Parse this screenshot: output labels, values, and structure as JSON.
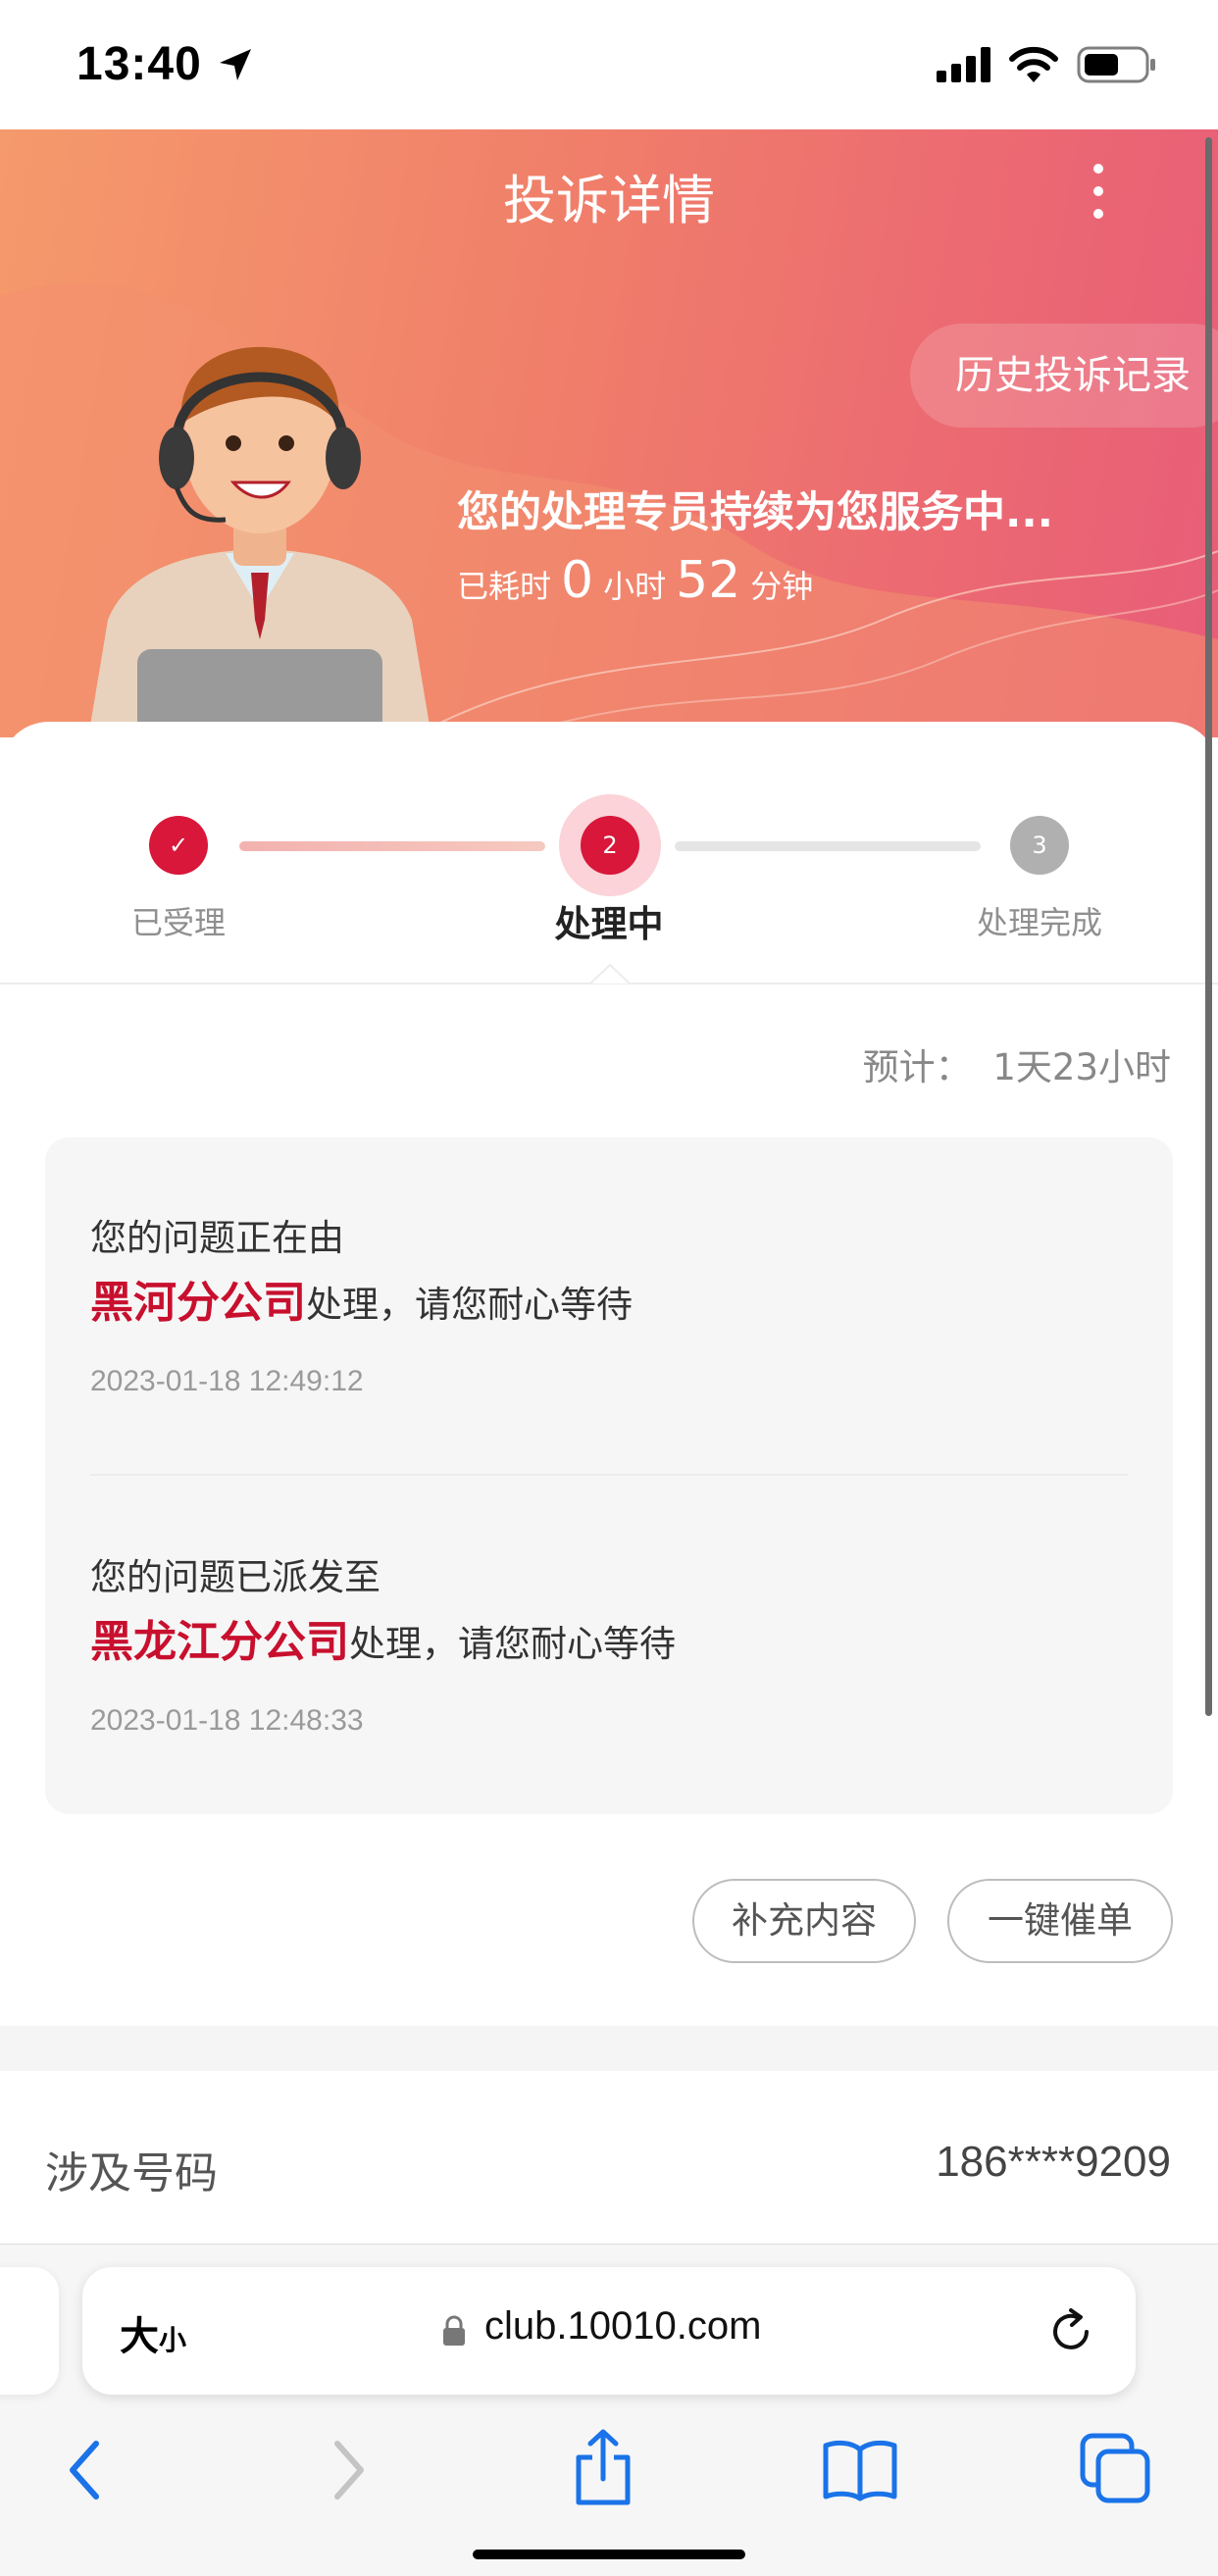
{
  "status_bar": {
    "time": "13:40"
  },
  "header": {
    "title": "投诉详情",
    "history_button": "历史投诉记录",
    "service_message": "您的处理专员持续为您服务中...",
    "elapsed": {
      "prefix": "已耗时",
      "hours": "0",
      "hours_unit": "小时",
      "minutes": "52",
      "minutes_unit": "分钟"
    }
  },
  "progress": {
    "steps": [
      {
        "label": "已受理",
        "number": "✓",
        "state": "done"
      },
      {
        "label": "处理中",
        "number": "2",
        "state": "active"
      },
      {
        "label": "处理完成",
        "number": "3",
        "state": "pending"
      }
    ]
  },
  "eta": {
    "label": "预计：",
    "value": "1天23小时"
  },
  "timeline": [
    {
      "line1": "您的问题正在由",
      "org": "黑河分公司",
      "suffix": "处理，请您耐心等待",
      "time": "2023-01-18 12:49:12"
    },
    {
      "line1": "您的问题已派发至",
      "org": "黑龙江分公司",
      "suffix": "处理，请您耐心等待",
      "time": "2023-01-18 12:48:33"
    }
  ],
  "actions": {
    "supplement": "补充内容",
    "urge": "一键催单"
  },
  "involved_number": {
    "label": "涉及号码",
    "value": "186****9209"
  },
  "browser": {
    "text_size_big": "大",
    "text_size_small": "小",
    "url": "club.10010.com"
  },
  "colors": {
    "accent": "#d8173a",
    "hero_start": "#f59a6c",
    "hero_end": "#e85d78",
    "org_text": "#c8102e"
  }
}
